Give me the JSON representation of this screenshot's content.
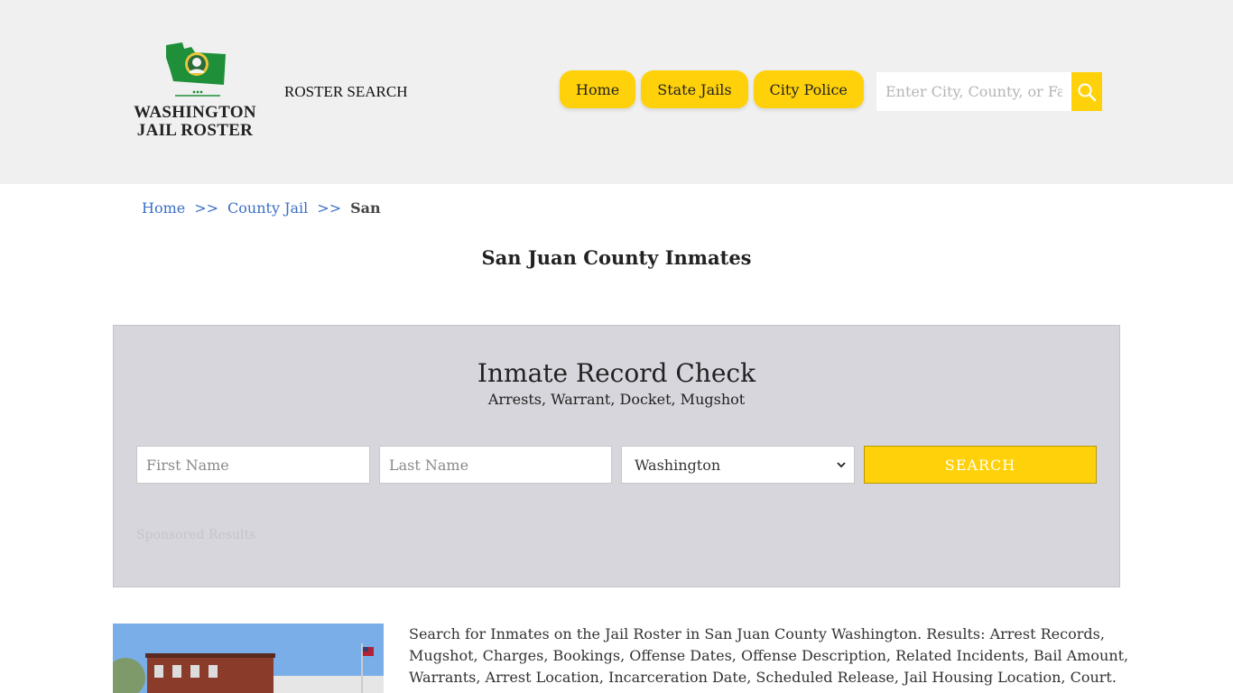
{
  "header": {
    "logo": {
      "line1": "WASHINGTON",
      "line2": "JAIL ROSTER"
    },
    "roster_search": "ROSTER SEARCH",
    "nav": [
      {
        "label": "Home"
      },
      {
        "label": "State Jails"
      },
      {
        "label": "City Police"
      }
    ],
    "search": {
      "placeholder": "Enter City, County, or Facility"
    }
  },
  "breadcrumb": {
    "items": [
      "Home",
      "County Jail"
    ],
    "separator": ">>",
    "current": "San"
  },
  "page_title": "San Juan County Inmates",
  "record_check": {
    "title": "Inmate Record Check",
    "subtitle": "Arrests, Warrant, Docket, Mugshot",
    "first_name_placeholder": "First Name",
    "last_name_placeholder": "Last Name",
    "state_selected": "Washington",
    "search_label": "SEARCH",
    "sponsored": "Sponsored Results"
  },
  "content": {
    "description": "Search for Inmates on the Jail Roster in San Juan County Washington. Results: Arrest Records, Mugshot, Charges, Bookings, Offense Dates, Offense Description, Related Incidents, Bail Amount, Warrants, Arrest Location, Incarceration Date, Scheduled Release, Jail Housing Location, Court."
  },
  "colors": {
    "accent_yellow": "#ffd10a",
    "header_bg": "#f0f0f0",
    "panel_bg": "#d6d6dc",
    "link_blue": "#3a6fc4",
    "logo_green": "#1f8f3a"
  }
}
